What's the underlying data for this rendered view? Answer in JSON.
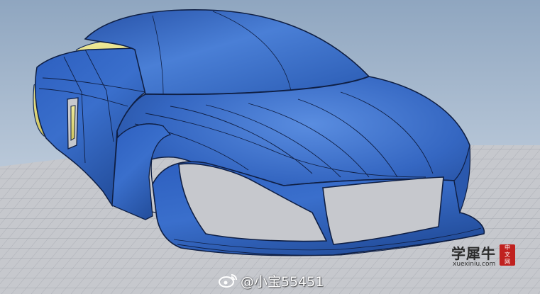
{
  "viewport": {
    "name": "3d-modeling-viewport"
  },
  "logo": {
    "main_text": "学犀牛",
    "stamp_text": "中文网",
    "url_text": "xuexiniu.com"
  },
  "watermark": {
    "icon": "weibo-icon",
    "text": "@小宝55451"
  },
  "colors": {
    "car_body": "#2f5fb8",
    "interior": "#e6df7a",
    "grid_floor": "#c4c6cc",
    "grid_lines": "#9a9ea6"
  }
}
